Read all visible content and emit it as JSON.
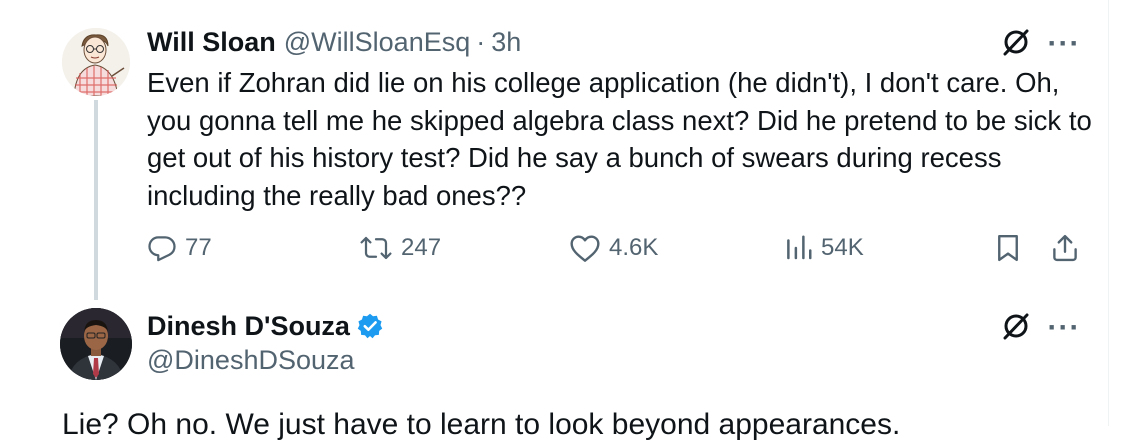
{
  "tweet1": {
    "author_name": "Will Sloan",
    "author_handle": "@WillSloanEsq",
    "separator": "·",
    "time": "3h",
    "text": "Even if Zohran did lie on his college application (he didn't), I don't care. Oh, you gonna tell me he skipped algebra class next? Did he pretend to be sick to get out of his history test? Did he say a bunch of swears during recess including the really bad ones??",
    "replies": "77",
    "reposts": "247",
    "likes": "4.6K",
    "views": "54K",
    "more_label": "···"
  },
  "tweet2": {
    "author_name": "Dinesh D'Souza",
    "author_handle": "@DineshDSouza",
    "text": "Lie? Oh no. We just have to learn to look beyond appearances.",
    "more_label": "···"
  },
  "colors": {
    "text_primary": "#0f1419",
    "text_secondary": "#536471",
    "verified_blue": "#1d9bf0",
    "thread_line": "#cfd9de"
  },
  "icons": {
    "reply": "reply-icon",
    "repost": "repost-icon",
    "like": "heart-icon",
    "views": "views-icon",
    "bookmark": "bookmark-icon",
    "share": "share-icon",
    "grok": "grok-icon",
    "more": "more-icon",
    "verified": "verified-badge-icon"
  }
}
